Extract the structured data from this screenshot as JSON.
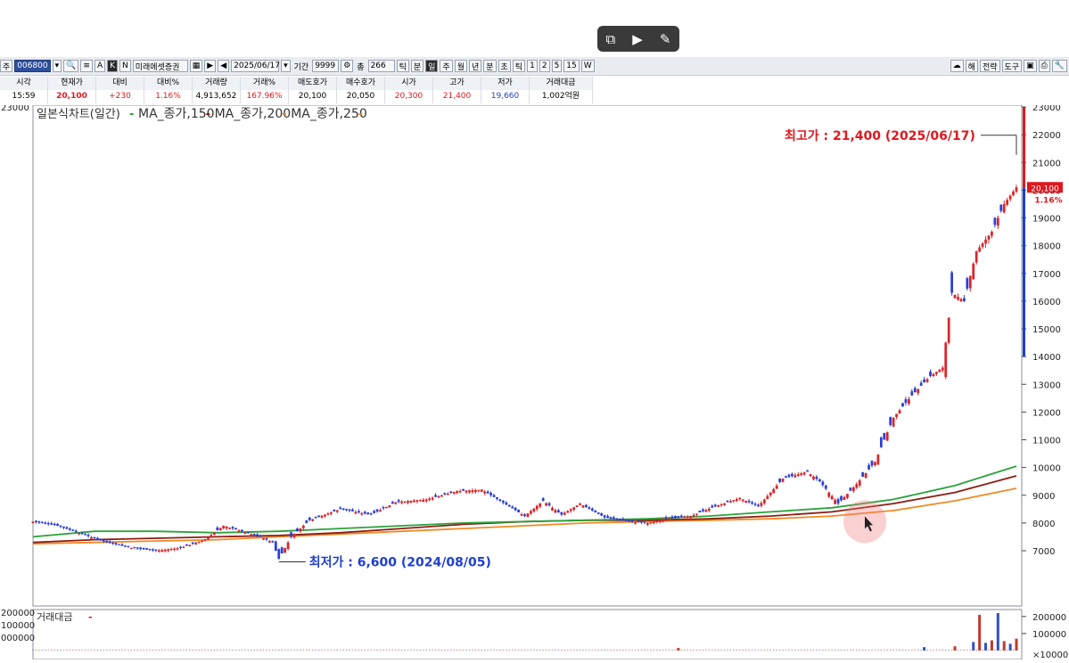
{
  "overlay": {
    "icons": [
      "screen-capture-icon",
      "video-capture-icon",
      "note-icon"
    ]
  },
  "toolbar": {
    "code_label": "주",
    "code_value": "006800",
    "company": "미래에셋증권",
    "btn_a": "A",
    "btn_k": "K",
    "btn_n": "N",
    "date": "2025/06/17",
    "period_label": "기간",
    "period_value": "9999",
    "count_label": "총",
    "count_value": "266",
    "intervals": [
      "틱",
      "분",
      "일",
      "주",
      "월",
      "년",
      "분",
      "초",
      "틱",
      "1",
      "2",
      "5",
      "15",
      "W"
    ],
    "right_buttons": [
      "해",
      "전략",
      "도구"
    ]
  },
  "info": {
    "headers": [
      "시각",
      "현재가",
      "대비",
      "대비%",
      "거래량",
      "거래%",
      "매도호가",
      "매수호가",
      "시가",
      "고가",
      "저가",
      "거래대금"
    ],
    "values": [
      "15:59",
      "20,100",
      "+230",
      "1.16%",
      "4,913,652",
      "167.96%",
      "20,100",
      "20,050",
      "20,300",
      "21,400",
      "19,660",
      "1,002억원"
    ],
    "colors": [
      "#000000",
      "#e0181e",
      "#e0181e",
      "#e0181e",
      "#000000",
      "#e0181e",
      "#000000",
      "#000000",
      "#e0181e",
      "#e0181e",
      "#1f3fd0",
      "#000000"
    ]
  },
  "chart_data": {
    "type": "candlestick",
    "title": "일본식차트(일간)",
    "legend": [
      {
        "name": "MA_종가,150",
        "color": "#2aa33a"
      },
      {
        "name": "MA_종가,200",
        "color": "#8a1f14"
      },
      {
        "name": "MA_종가,250",
        "color": "#f08a24"
      }
    ],
    "ylim": [
      6000,
      23000
    ],
    "y_ticks": [
      7000,
      8000,
      9000,
      10000,
      11000,
      12000,
      13000,
      14000,
      15000,
      16000,
      17000,
      18000,
      19000,
      20000,
      21000,
      22000,
      23000
    ],
    "y_tick_labels": [
      "7000",
      "8000",
      "9000",
      "10000",
      "11000",
      "12000",
      "13000",
      "14000",
      "15000",
      "16000",
      "17000",
      "18000",
      "19000",
      "20000",
      "21000",
      "22000",
      "23000"
    ],
    "left_tick_label": "23000",
    "high_annotation": "최고가 : 21,400 (2025/06/17)",
    "low_annotation": "최저가 : 6,600 (2024/08/05)",
    "current_price": "20,100",
    "current_change": "1.16%",
    "price_path": [
      [
        0,
        8050
      ],
      [
        8,
        7900
      ],
      [
        16,
        7600
      ],
      [
        24,
        7300
      ],
      [
        32,
        7100
      ],
      [
        40,
        7000
      ],
      [
        48,
        7100
      ],
      [
        56,
        7400
      ],
      [
        62,
        7900
      ],
      [
        68,
        7700
      ],
      [
        74,
        7500
      ],
      [
        78,
        7300
      ],
      [
        80,
        6700
      ],
      [
        84,
        7500
      ],
      [
        90,
        8100
      ],
      [
        100,
        8500
      ],
      [
        110,
        8300
      ],
      [
        118,
        8750
      ],
      [
        128,
        8850
      ],
      [
        138,
        9150
      ],
      [
        146,
        9200
      ],
      [
        152,
        8800
      ],
      [
        160,
        8250
      ],
      [
        166,
        8800
      ],
      [
        172,
        8300
      ],
      [
        178,
        8700
      ],
      [
        186,
        8200
      ],
      [
        194,
        8050
      ],
      [
        200,
        8000
      ],
      [
        206,
        8150
      ],
      [
        214,
        8250
      ],
      [
        222,
        8600
      ],
      [
        230,
        8900
      ],
      [
        236,
        8600
      ],
      [
        244,
        9600
      ],
      [
        252,
        9850
      ],
      [
        256,
        9500
      ],
      [
        262,
        8700
      ],
      [
        268,
        9400
      ],
      [
        274,
        10200
      ],
      [
        280,
        11800
      ],
      [
        286,
        12600
      ],
      [
        292,
        13300
      ],
      [
        296,
        13600
      ],
      [
        299,
        16300
      ],
      [
        303,
        16000
      ],
      [
        307,
        17800
      ],
      [
        312,
        18500
      ],
      [
        316,
        19500
      ],
      [
        320,
        20100
      ]
    ],
    "ma150": [
      [
        0,
        7500
      ],
      [
        20,
        7700
      ],
      [
        40,
        7700
      ],
      [
        60,
        7650
      ],
      [
        80,
        7700
      ],
      [
        100,
        7800
      ],
      [
        120,
        7900
      ],
      [
        140,
        8000
      ],
      [
        160,
        8050
      ],
      [
        180,
        8100
      ],
      [
        200,
        8150
      ],
      [
        220,
        8250
      ],
      [
        240,
        8400
      ],
      [
        260,
        8550
      ],
      [
        280,
        8850
      ],
      [
        300,
        9350
      ],
      [
        320,
        10050
      ]
    ],
    "ma200": [
      [
        0,
        7300
      ],
      [
        20,
        7400
      ],
      [
        40,
        7450
      ],
      [
        60,
        7500
      ],
      [
        80,
        7550
      ],
      [
        100,
        7650
      ],
      [
        120,
        7800
      ],
      [
        140,
        7950
      ],
      [
        160,
        8050
      ],
      [
        180,
        8100
      ],
      [
        200,
        8100
      ],
      [
        220,
        8150
      ],
      [
        240,
        8250
      ],
      [
        260,
        8400
      ],
      [
        280,
        8700
      ],
      [
        300,
        9100
      ],
      [
        320,
        9700
      ]
    ],
    "ma250": [
      [
        0,
        7250
      ],
      [
        20,
        7300
      ],
      [
        40,
        7350
      ],
      [
        60,
        7400
      ],
      [
        80,
        7500
      ],
      [
        100,
        7600
      ],
      [
        120,
        7700
      ],
      [
        140,
        7800
      ],
      [
        160,
        7900
      ],
      [
        180,
        8000
      ],
      [
        200,
        8050
      ],
      [
        220,
        8100
      ],
      [
        240,
        8150
      ],
      [
        260,
        8250
      ],
      [
        280,
        8450
      ],
      [
        300,
        8800
      ],
      [
        320,
        9250
      ]
    ],
    "volume_panel": {
      "label": "거래대금",
      "ticks": [
        100000,
        200000
      ],
      "tick_labels": [
        "100000",
        "200000"
      ],
      "unit_label": "×10000",
      "left_labels": [
        "200000",
        "100000",
        "000000"
      ],
      "spikes": [
        [
          210,
          15000
        ],
        [
          290,
          20000
        ],
        [
          300,
          25000
        ],
        [
          306,
          50000
        ],
        [
          308,
          210000
        ],
        [
          310,
          45000
        ],
        [
          312,
          60000
        ],
        [
          314,
          220000
        ],
        [
          316,
          55000
        ],
        [
          318,
          40000
        ],
        [
          320,
          70000
        ]
      ]
    }
  }
}
